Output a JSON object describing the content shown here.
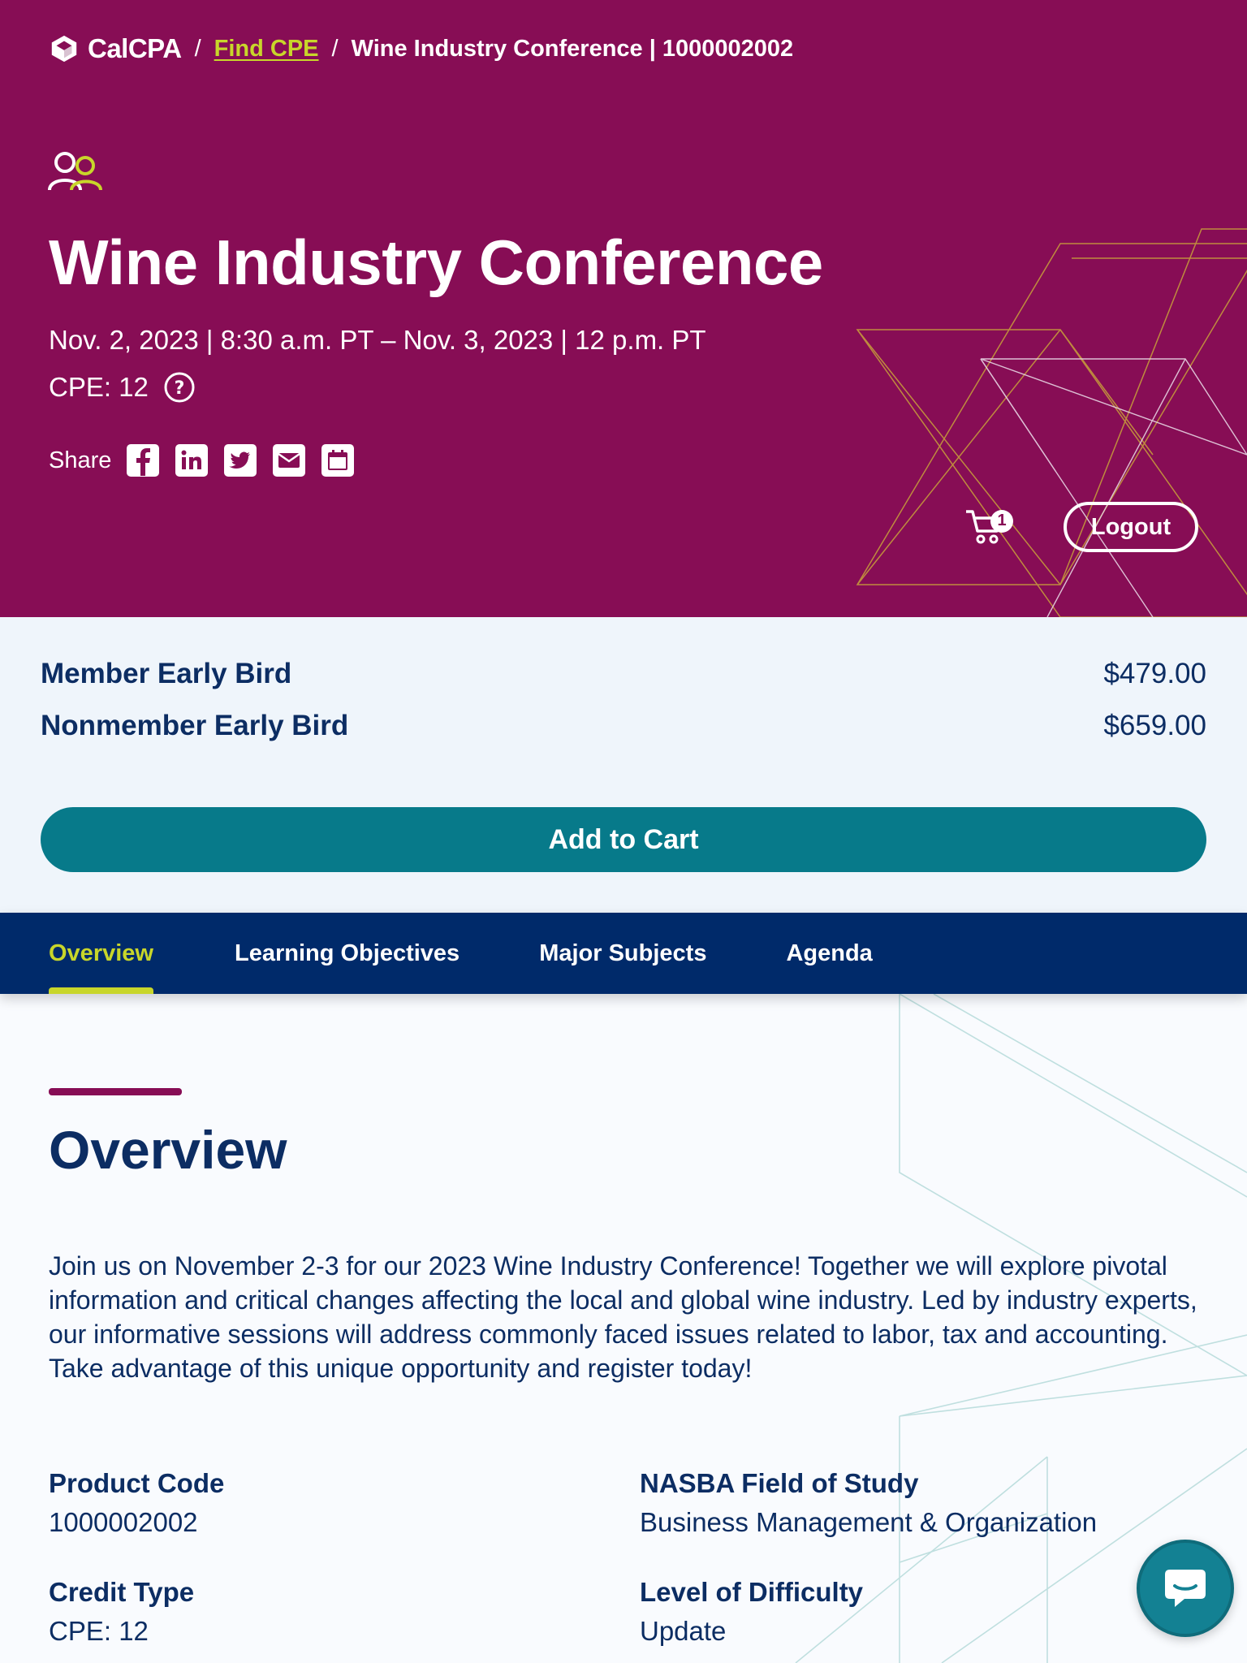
{
  "breadcrumb": {
    "logo_text": "CalCPA",
    "separator": "/",
    "find_cpe": "Find CPE",
    "current": "Wine Industry Conference | 1000002002"
  },
  "hero": {
    "title": "Wine Industry Conference",
    "dates": "Nov. 2, 2023 | 8:30 a.m. PT – Nov. 3, 2023 | 12 p.m. PT",
    "cpe_label": "CPE: 12",
    "share_label": "Share",
    "share_icons": [
      "facebook-icon",
      "linkedin-icon",
      "twitter-icon",
      "email-icon",
      "calendar-icon"
    ],
    "cart_count": "1",
    "logout_label": "Logout"
  },
  "pricing": {
    "items": [
      {
        "name": "Member Early Bird",
        "price": "$479.00"
      },
      {
        "name": "Nonmember Early Bird",
        "price": "$659.00"
      }
    ],
    "add_to_cart": "Add to Cart"
  },
  "tabs": [
    {
      "label": "Overview",
      "active": true
    },
    {
      "label": "Learning Objectives",
      "active": false
    },
    {
      "label": "Major Subjects",
      "active": false
    },
    {
      "label": "Agenda",
      "active": false
    }
  ],
  "overview": {
    "heading": "Overview",
    "body": "Join us on November 2-3 for our 2023 Wine Industry Conference! Together we will explore pivotal information and critical changes affecting the local and global wine industry. Led by industry experts, our informative sessions will address commonly faced issues related to labor, tax and accounting. Take advantage of this unique opportunity and register today!",
    "fields": {
      "product_code": {
        "label": "Product Code",
        "value": "1000002002"
      },
      "nasba": {
        "label": "NASBA Field of Study",
        "value": "Business Management & Organization"
      },
      "credit_type": {
        "label": "Credit Type",
        "value": "CPE: 12"
      },
      "difficulty": {
        "label": "Level of Difficulty",
        "value": "Update"
      }
    }
  },
  "colors": {
    "hero_bg": "#870d55",
    "accent_lime": "#c8d62a",
    "navy": "#0c2d63",
    "teal_button": "#077a8a",
    "tab_bar": "#002a6a"
  }
}
